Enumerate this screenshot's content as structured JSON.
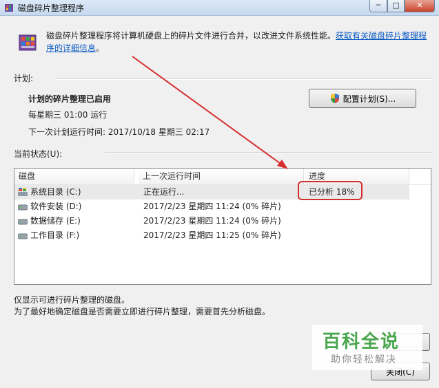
{
  "window": {
    "title": "磁盘碎片整理程序"
  },
  "caption_buttons": {
    "minimize": "─",
    "maximize": "□",
    "close": "✕"
  },
  "intro": {
    "text": "磁盘碎片整理程序将计算机硬盘上的碎片文件进行合并，以改进文件系统性能。",
    "link": "获取有关磁盘碎片整理程序的详细信息",
    "suffix": "。"
  },
  "schedule": {
    "group_label": "计划:",
    "status": "计划的碎片整理已启用",
    "frequency": "每星期三  01:00 运行",
    "next_run": "下一次计划运行时间: 2017/10/18 星期三 02:17",
    "button_label": "配置计划(S)..."
  },
  "current_status": {
    "group_label": "当前状态(U):",
    "columns": [
      "磁盘",
      "上一次运行时间",
      "进度"
    ],
    "rows": [
      {
        "disk": "系统目录 (C:)",
        "last_run": "正在运行...",
        "progress": "已分析 18%",
        "icon": "system-drive-icon"
      },
      {
        "disk": "软件安装 (D:)",
        "last_run": "2017/2/23 星期四 11:24 (0% 碎片)",
        "progress": "",
        "icon": "drive-icon"
      },
      {
        "disk": "数据储存 (E:)",
        "last_run": "2017/2/23 星期四 11:24 (0% 碎片)",
        "progress": "",
        "icon": "drive-icon"
      },
      {
        "disk": "工作目录 (F:)",
        "last_run": "2017/2/23 星期四 11:25 (0% 碎片)",
        "progress": "",
        "icon": "drive-icon"
      }
    ]
  },
  "notes": {
    "line1": "仅显示可进行碎片整理的磁盘。",
    "line2": "为了最好地确定磁盘是否需要立即进行碎片整理，需要首先分析磁盘。"
  },
  "buttons": {
    "analyze": "",
    "close": "关闭(C)"
  },
  "watermark": {
    "title": "百科全说",
    "subtitle": "助你轻松解决"
  },
  "colors": {
    "annotation": "#d52e2e",
    "link": "#0b5bc4",
    "watermark": "#49a64e"
  }
}
